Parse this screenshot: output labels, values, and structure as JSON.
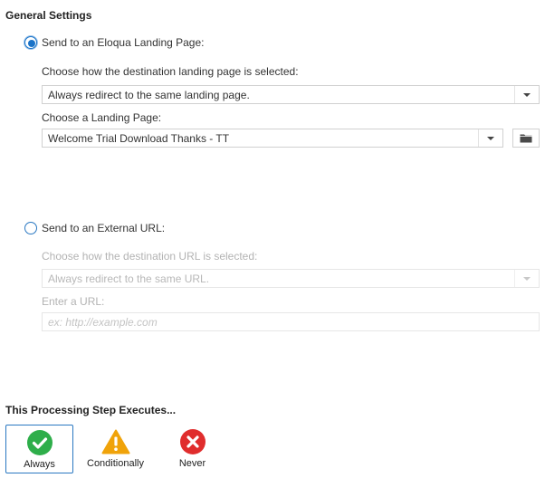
{
  "general": {
    "title": "General Settings",
    "landing": {
      "radio_label": "Send to an Eloqua Landing Page:",
      "selected": true,
      "method_label": "Choose how the destination landing page is selected:",
      "method_value": "Always redirect to the same landing page.",
      "page_label": "Choose a Landing Page:",
      "page_value": "Welcome Trial Download Thanks - TT"
    },
    "external": {
      "radio_label": "Send to an External URL:",
      "selected": false,
      "method_label": "Choose how the destination URL is selected:",
      "method_value": "Always redirect to the same URL.",
      "url_label": "Enter a URL:",
      "url_placeholder": "ex: http://example.com"
    }
  },
  "execution": {
    "title": "This Processing Step Executes...",
    "options": [
      {
        "label": "Always",
        "icon": "check-circle-icon",
        "color": "#2eae4a",
        "selected": true
      },
      {
        "label": "Conditionally",
        "icon": "warning-triangle-icon",
        "color": "#f0a30a",
        "selected": false
      },
      {
        "label": "Never",
        "icon": "x-circle-icon",
        "color": "#e02d2d",
        "selected": false
      }
    ]
  },
  "colors": {
    "accent": "#1a73c8",
    "disabled_text": "#b3b3b3"
  }
}
